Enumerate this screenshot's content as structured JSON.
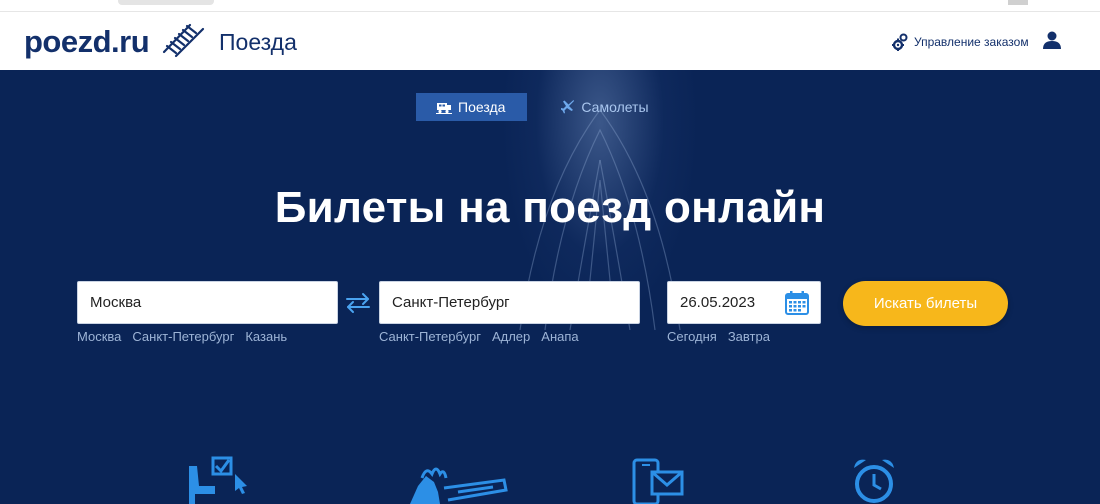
{
  "header": {
    "logo": "poezd.ru",
    "section_title": "Поезда",
    "manage_label": "Управление заказом"
  },
  "tabs": [
    {
      "label": "Поезда",
      "icon": "train-icon",
      "active": true
    },
    {
      "label": "Самолеты",
      "icon": "plane-icon",
      "active": false
    }
  ],
  "hero": {
    "title": "Билеты на поезд онлайн"
  },
  "search": {
    "from_value": "Москва",
    "from_suggestions": [
      "Москва",
      "Санкт-Петербург",
      "Казань"
    ],
    "to_value": "Санкт-Петербург",
    "to_suggestions": [
      "Санкт-Петербург",
      "Адлер",
      "Анапа"
    ],
    "date_value": "26.05.2023",
    "date_suggestions": [
      "Сегодня",
      "Завтра"
    ],
    "button_label": "Искать билеты"
  },
  "features": [
    {
      "icon": "seat-select-icon"
    },
    {
      "icon": "hand-ticket-icon"
    },
    {
      "icon": "phone-mail-icon"
    },
    {
      "icon": "alarm-clock-icon"
    }
  ],
  "colors": {
    "brand": "#13306b",
    "hero_bg": "#0a2456",
    "active_tab": "#2a5ba8",
    "accent_button": "#f7b71b",
    "icon_blue": "#2c8fe6"
  }
}
